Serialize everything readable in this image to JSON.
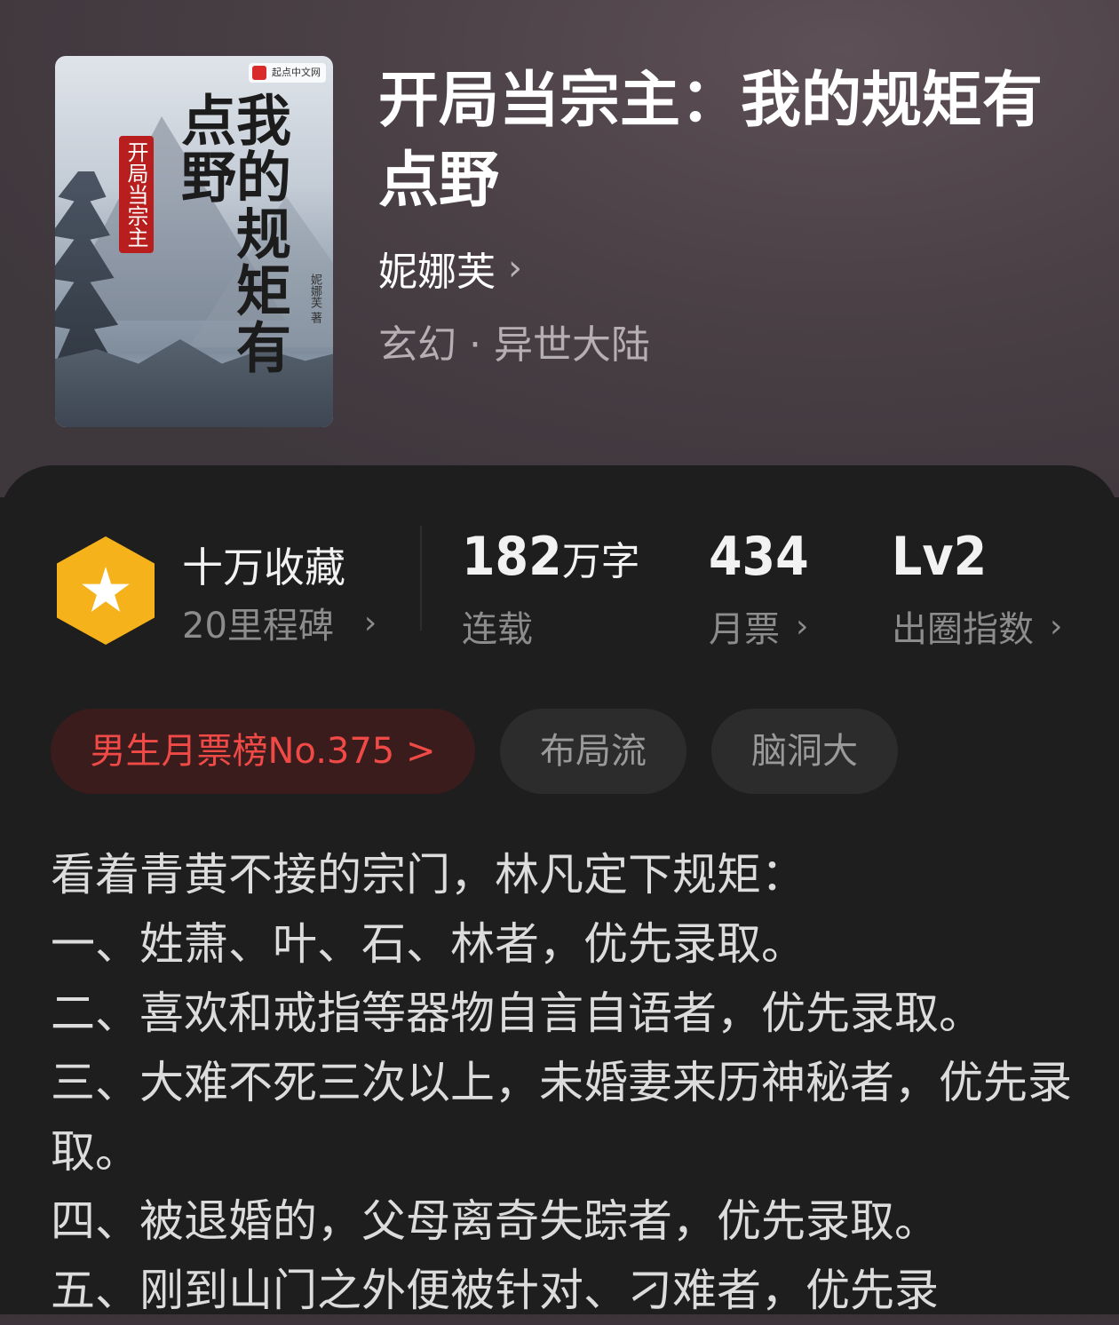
{
  "book": {
    "title": "开局当宗主：我的规矩有点野",
    "author": "妮娜芙",
    "genre": "玄幻 · 异世大陆",
    "cover": {
      "publisher_badge": "起点中文网",
      "title_art": "我的规矩有点野",
      "subtitle_art": "开局当宗主",
      "author_art": "妮娜芙 著"
    }
  },
  "stats": {
    "collections": {
      "main": "十万收藏",
      "sub": "20里程碑"
    },
    "words": {
      "value": "182",
      "unit": "万字",
      "label": "连载"
    },
    "monthly_votes": {
      "value": "434",
      "label": "月票"
    },
    "popularity": {
      "value": "Lv2",
      "label": "出圈指数"
    }
  },
  "tags": {
    "rank": "男生月票榜No.375 >",
    "items": [
      "布局流",
      "脑洞大"
    ]
  },
  "synopsis": [
    "看着青黄不接的宗门，林凡定下规矩：",
    "一、姓萧、叶、石、林者，优先录取。",
    "二、喜欢和戒指等器物自言自语者，优先录取。",
    "三、大难不死三次以上，未婚妻来历神秘者，优先录取。",
    "四、被退婚的，父母离奇失踪者，优先录取。",
    "五、刚到山门之外便被针对、刁难者，优先录"
  ],
  "colors": {
    "accent_red": "#f04a47",
    "badge_gold": "#f6b21a",
    "panel_bg": "#1e1e1e"
  }
}
